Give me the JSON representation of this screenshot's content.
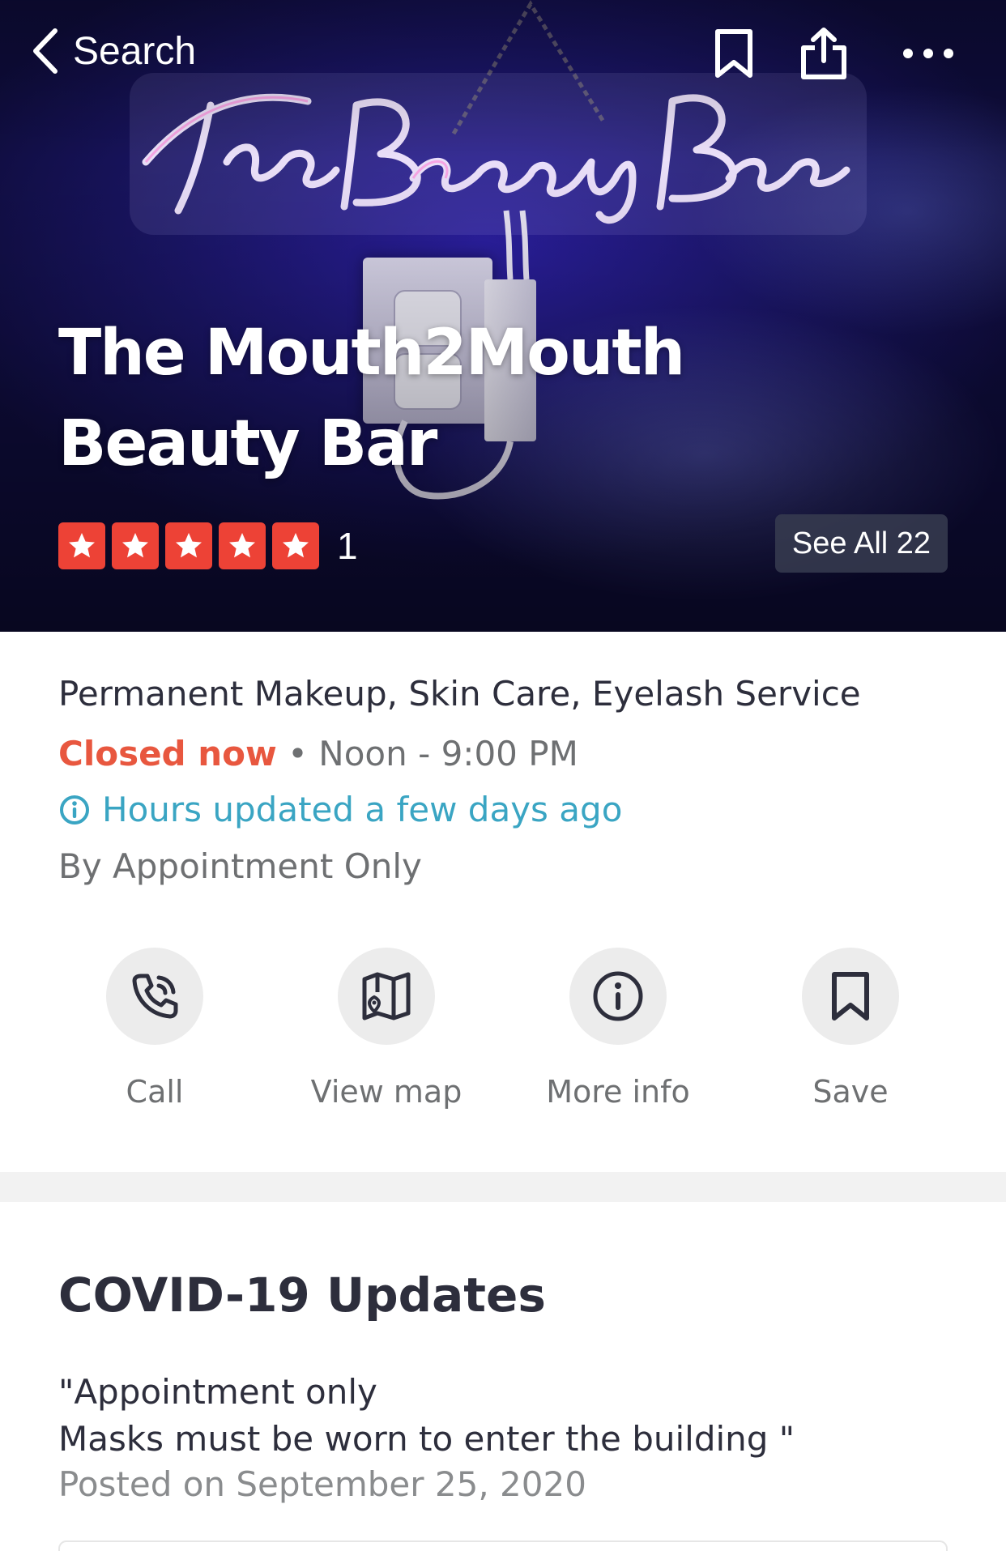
{
  "nav": {
    "back_label": "Search",
    "icons": [
      "chevron-left-icon",
      "bookmark-icon",
      "share-icon",
      "more-icon"
    ]
  },
  "hero": {
    "title_line1": "The Mouth2Mouth",
    "title_line2": "Beauty Bar",
    "rating_stars": 5,
    "review_count": "1",
    "see_all_label": "See All 22",
    "star_color": "#ed4236"
  },
  "info": {
    "categories": "Permanent Makeup, Skin Care, Eyelash Service",
    "status": "Closed now",
    "hours_separator": " • ",
    "hours": "Noon - 9:00 PM",
    "hours_updated": "Hours updated a few days ago",
    "appointment_note": "By Appointment Only",
    "status_color": "#e8573f",
    "link_color": "#3aa5c3"
  },
  "actions": [
    {
      "label": "Call",
      "icon": "phone-icon"
    },
    {
      "label": "View map",
      "icon": "map-icon"
    },
    {
      "label": "More info",
      "icon": "info-icon"
    },
    {
      "label": "Save",
      "icon": "bookmark-icon"
    }
  ],
  "covid": {
    "title": "COVID-19 Updates",
    "message": "\"Appointment only\nMasks must be worn to enter the building \"",
    "posted": "Posted on September 25, 2020"
  }
}
